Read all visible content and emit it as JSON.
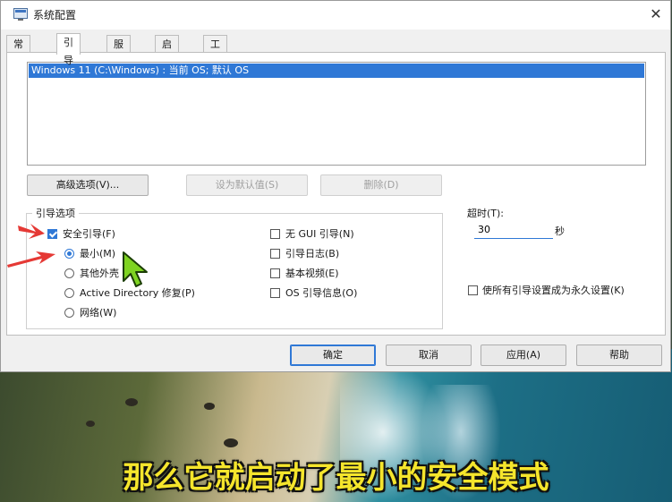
{
  "window": {
    "title": "系统配置"
  },
  "tabs": [
    {
      "label": "常规"
    },
    {
      "label": "引导"
    },
    {
      "label": "服务"
    },
    {
      "label": "启动"
    },
    {
      "label": "工具"
    }
  ],
  "os_list": {
    "entries": [
      "Windows 11 (C:\\Windows) : 当前 OS; 默认 OS"
    ]
  },
  "boot_buttons": {
    "advanced": "高级选项(V)...",
    "set_default": "设为默认值(S)",
    "delete": "删除(D)"
  },
  "boot_options": {
    "title": "引导选项",
    "safe_boot": {
      "label": "安全引导(F)",
      "checked": true
    },
    "minimal": {
      "label": "最小(M)",
      "selected": true
    },
    "alternate_shell": {
      "label": "其他外壳"
    },
    "active_directory": {
      "label": "Active Directory 修复(P)"
    },
    "network": {
      "label": "网络(W)"
    },
    "no_gui": {
      "label": "无 GUI 引导(N)",
      "checked": false
    },
    "boot_log": {
      "label": "引导日志(B)",
      "checked": false
    },
    "base_video": {
      "label": "基本视频(E)",
      "checked": false
    },
    "os_boot_info": {
      "label": "OS 引导信息(O)",
      "checked": false
    }
  },
  "timeout": {
    "label": "超时(T):",
    "value": "30",
    "unit": "秒"
  },
  "permanent": {
    "label": "使所有引导设置成为永久设置(K)",
    "checked": false
  },
  "dialog_buttons": {
    "ok": "确定",
    "cancel": "取消",
    "apply": "应用(A)",
    "help": "帮助"
  },
  "subtitle": "那么它就启动了最小的安全模式",
  "colors": {
    "accent": "#2f78d6",
    "annotation_arrow": "#e53935",
    "cursor": "#7ed321",
    "subtitle": "#f5e52c"
  }
}
